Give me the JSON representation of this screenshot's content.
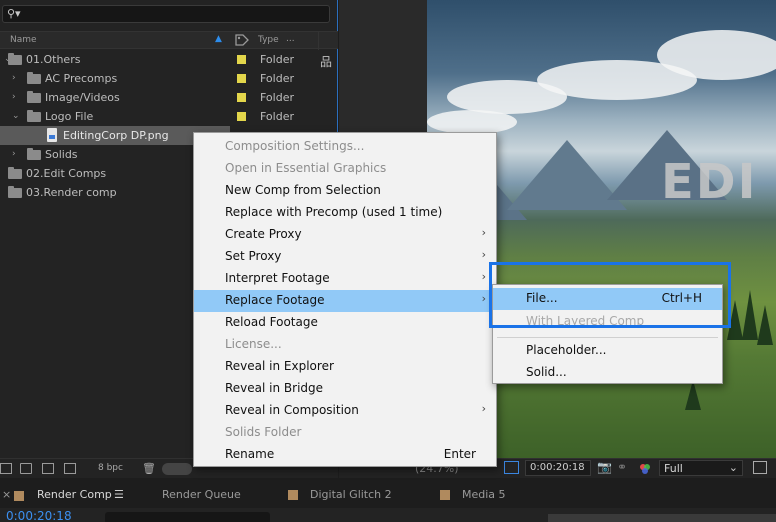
{
  "project_panel": {
    "search": {
      "placeholder": "",
      "value": ""
    },
    "columns": {
      "name": "Name",
      "type": "Type",
      "type_more": "..."
    },
    "items": [
      {
        "name": "01.Others",
        "type": "Folder",
        "label_color": "#e3d64b"
      },
      {
        "name": "AC Precomps",
        "type": "Folder",
        "label_color": "#e3d64b"
      },
      {
        "name": "Image/Videos",
        "type": "Folder",
        "label_color": "#e3d64b"
      },
      {
        "name": "Logo File",
        "type": "Folder",
        "label_color": "#e3d64b"
      },
      {
        "name": "EditingCorp DP.png",
        "type": "",
        "selected": true
      },
      {
        "name": "Solids",
        "type": ""
      },
      {
        "name": "02.Edit Comps",
        "type": ""
      },
      {
        "name": "03.Render comp",
        "type": ""
      }
    ],
    "bit_depth": "8 bpc"
  },
  "viewer": {
    "comp_text": "EDI",
    "zoom_label": "(24.7%)",
    "timecode": "0:00:20:18",
    "resolution": "Full"
  },
  "tabs": [
    {
      "label": "Render Comp",
      "active": true,
      "menu": "☰"
    },
    {
      "label": "Render Queue"
    },
    {
      "label": "Digital Glitch 2"
    },
    {
      "label": "Media 5"
    }
  ],
  "timeline": {
    "timecode": "0:00:20:18"
  },
  "context_menu": {
    "items": [
      {
        "label": "Composition Settings...",
        "disabled": true
      },
      {
        "label": "Open in Essential Graphics",
        "disabled": true
      },
      {
        "label": "New Comp from Selection"
      },
      {
        "label": "Replace with Precomp (used 1 time)"
      },
      {
        "label": "Create Proxy",
        "submenu": true
      },
      {
        "label": "Set Proxy",
        "submenu": true
      },
      {
        "label": "Interpret Footage",
        "submenu": true
      },
      {
        "label": "Replace Footage",
        "submenu": true,
        "active": true
      },
      {
        "label": "Reload Footage"
      },
      {
        "label": "License...",
        "disabled": true
      },
      {
        "label": "Reveal in Explorer"
      },
      {
        "label": "Reveal in Bridge"
      },
      {
        "label": "Reveal in Composition",
        "submenu": true
      },
      {
        "label": "Solids Folder",
        "disabled": true
      },
      {
        "label": "Rename",
        "shortcut": "Enter"
      }
    ]
  },
  "submenu": {
    "items": [
      {
        "label": "File...",
        "shortcut": "Ctrl+H",
        "active": true
      },
      {
        "label": "With Layered Comp",
        "disabled": true
      },
      {
        "label": "Placeholder..."
      },
      {
        "label": "Solid..."
      }
    ]
  },
  "colors": {
    "accent": "#2d8ceb",
    "menu_highlight": "#91c9f7",
    "annotation_box": "#1a73e8",
    "folder_label": "#e3d64b"
  }
}
